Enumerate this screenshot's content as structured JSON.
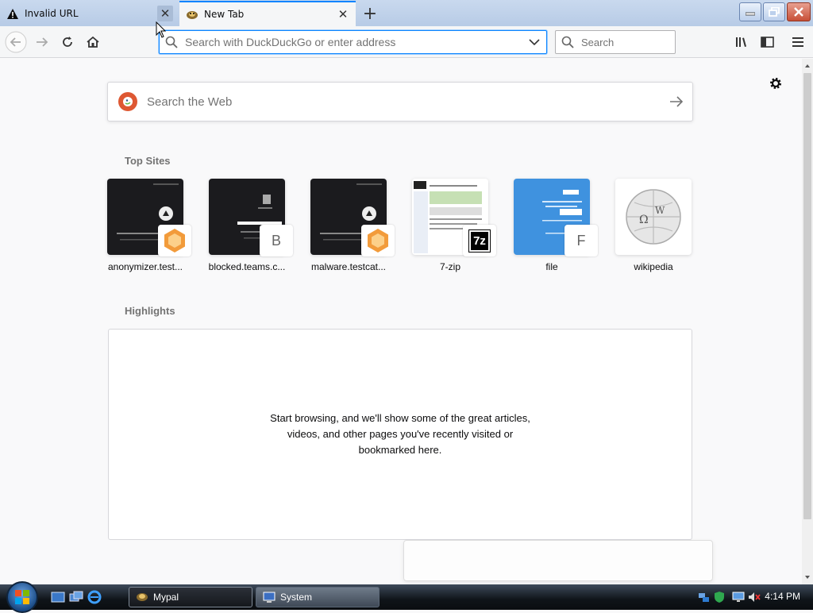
{
  "tabs": [
    {
      "title": "Invalid URL",
      "icon": "warning-icon"
    },
    {
      "title": "New Tab",
      "icon": "mypal-icon"
    }
  ],
  "window_controls": [
    "minimize-icon",
    "restore-icon",
    "close-icon"
  ],
  "urlbar": {
    "placeholder": "Search with DuckDuckGo or enter address"
  },
  "searchbar": {
    "placeholder": "Search"
  },
  "newtab": {
    "search_placeholder": "Search the Web",
    "top_sites_title": "Top Sites",
    "top_sites": [
      {
        "label": "anonymizer.test...",
        "badge": "",
        "theme": "dark"
      },
      {
        "label": "blocked.teams.c...",
        "badge": "B",
        "theme": "dark"
      },
      {
        "label": "malware.testcat...",
        "badge": "",
        "theme": "dark"
      },
      {
        "label": "7-zip",
        "badge": "7z",
        "theme": "light"
      },
      {
        "label": "file",
        "badge": "F",
        "theme": "blue"
      },
      {
        "label": "wikipedia",
        "badge": "",
        "theme": "light"
      }
    ],
    "highlights_title": "Highlights",
    "highlights_message": "Start browsing, and we'll show some of the great articles, videos, and other pages you've recently visited or bookmarked here."
  },
  "taskbar": {
    "items": [
      {
        "label": "Mypal",
        "active": true
      },
      {
        "label": "System",
        "active": false
      }
    ],
    "clock": "4:14 PM"
  },
  "colors": {
    "accent": "#0a84ff",
    "ddg": "#de5833",
    "file_blue": "#3f92df"
  }
}
